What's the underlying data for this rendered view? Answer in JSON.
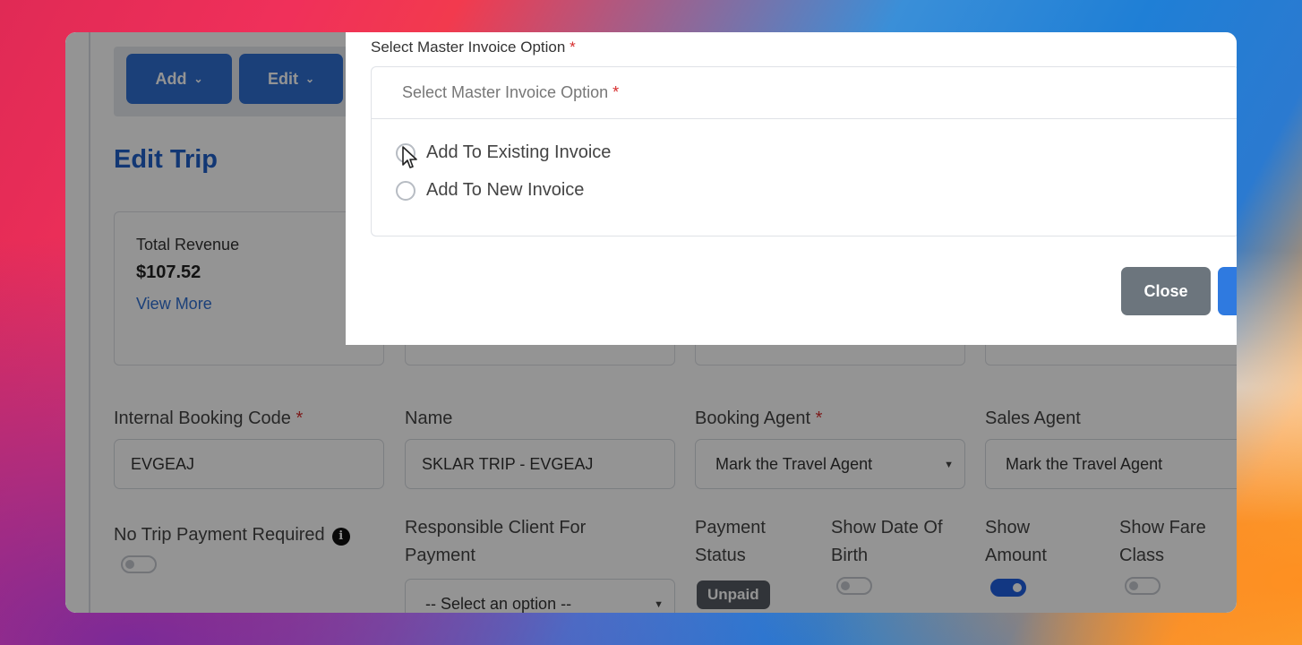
{
  "toolbar": {
    "add_label": "Add",
    "edit_label": "Edit"
  },
  "page": {
    "title": "Edit Trip"
  },
  "revenue_card": {
    "label": "Total Revenue",
    "value": "$107.52",
    "link": "View More"
  },
  "fields": {
    "internal_booking_code": {
      "label": "Internal Booking Code",
      "required": "*",
      "value": "EVGEAJ"
    },
    "name": {
      "label": "Name",
      "value": "SKLAR TRIP - EVGEAJ"
    },
    "booking_agent": {
      "label": "Booking Agent",
      "required": "*",
      "value": "Mark the Travel Agent"
    },
    "sales_agent": {
      "label": "Sales Agent",
      "value": "Mark the Travel Agent"
    },
    "no_trip_payment_required": {
      "label": "No Trip Payment Required",
      "on": false
    },
    "responsible_client": {
      "label_line1": "Responsible Client For",
      "label_line2": "Payment",
      "value": "-- Select an option --"
    },
    "payment_status": {
      "label_line1": "Payment",
      "label_line2": "Status",
      "value": "Unpaid"
    },
    "show_dob": {
      "label_line1": "Show Date Of",
      "label_line2": "Birth",
      "on": false
    },
    "show_amount": {
      "label_line1": "Show",
      "label_line2": "Amount",
      "on": true
    },
    "show_fare_class": {
      "label_line1": "Show Fare",
      "label_line2": "Class",
      "on": false
    }
  },
  "modal": {
    "field_label": "Select Master Invoice Option",
    "required": "*",
    "group_header": "Select Master Invoice Option",
    "options": [
      "Add To Existing Invoice",
      "Add To New Invoice"
    ],
    "close_label": "Close"
  },
  "colors": {
    "primary": "#2f6fd1",
    "title_blue": "#1f5fc8",
    "close_button": "#6c757d",
    "required": "#d62d2d"
  }
}
